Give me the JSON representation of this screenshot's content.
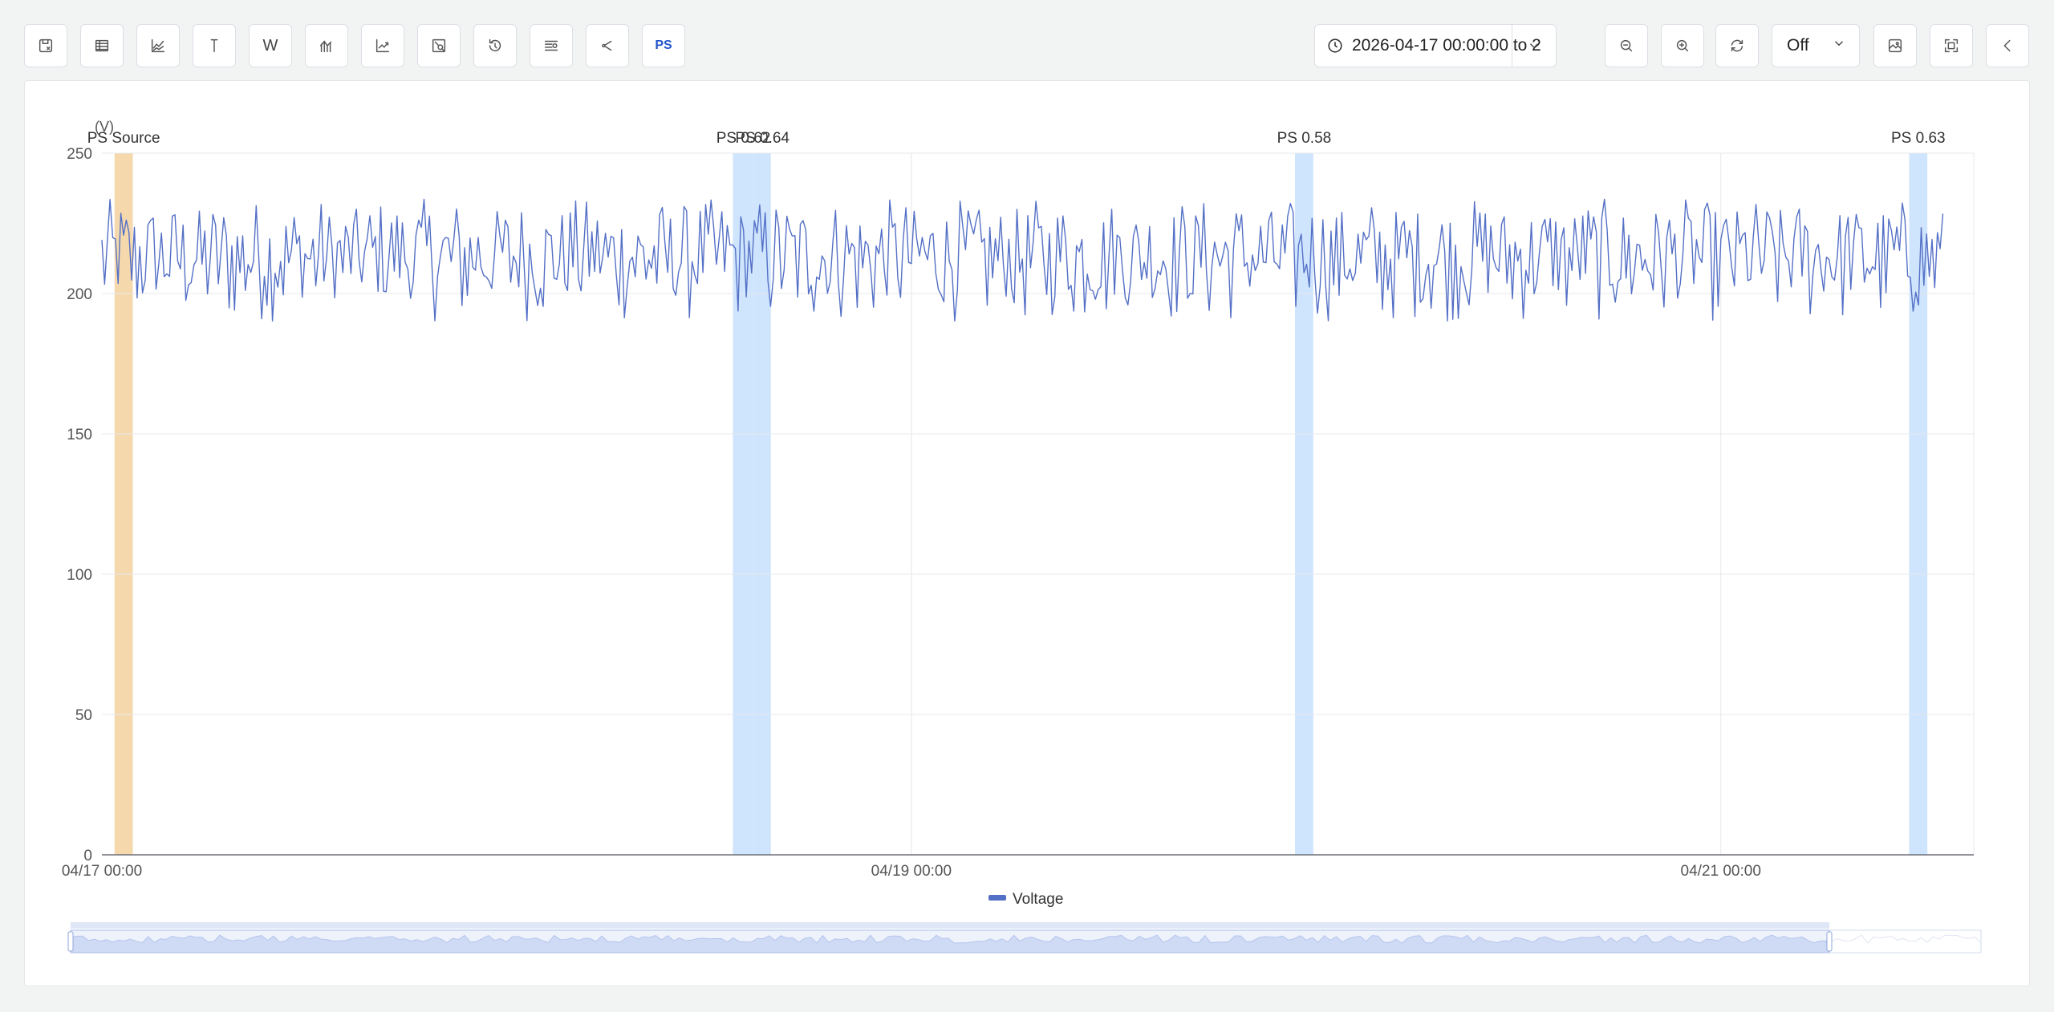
{
  "toolbar": {
    "left_buttons": [
      {
        "name": "save-icon"
      },
      {
        "name": "table-icon"
      },
      {
        "name": "line-chart-icon"
      },
      {
        "name": "cursor-icon"
      },
      {
        "name": "w-icon",
        "label": "W"
      },
      {
        "name": "multi-axis-icon"
      },
      {
        "name": "trend-icon"
      },
      {
        "name": "region-zoom-icon"
      },
      {
        "name": "history-icon"
      },
      {
        "name": "filter-icon"
      },
      {
        "name": "share-icon"
      },
      {
        "name": "ps-icon",
        "label": "PS"
      }
    ],
    "range_text": "2026-04-17 00:00:00 to 2",
    "refresh_select": "Off",
    "right_buttons": [
      {
        "name": "zoom-out-icon"
      },
      {
        "name": "zoom-in-icon"
      },
      {
        "name": "refresh-icon"
      },
      {
        "name": "export-image-icon"
      },
      {
        "name": "fullscreen-icon"
      },
      {
        "name": "collapse-icon"
      }
    ]
  },
  "colors": {
    "line": "#5470c6",
    "source_band": "#f5d9ad",
    "ps_band": "#cfe5fd",
    "grid": "#e6e8eb",
    "slider_fill": "#d9e2f7"
  },
  "chart_data": {
    "type": "line",
    "ylabel": "(V)",
    "ylim": [
      0,
      250
    ],
    "yticks": [
      0,
      50,
      100,
      150,
      200,
      250
    ],
    "xlim": [
      "04/17 00:00",
      "04/21 15:00"
    ],
    "xticks": [
      "04/17 00:00",
      "04/19 00:00",
      "04/21 00:00"
    ],
    "series": [
      {
        "name": "Voltage",
        "y_range": [
          190,
          236
        ],
        "mean": 212,
        "sampling": "dense, ~every 10 min"
      }
    ],
    "bands": [
      {
        "label": "PS Source",
        "start": "04/17 00:45",
        "end": "04/17 01:50",
        "kind": "source"
      },
      {
        "label": "PS 0.62",
        "start": "04/18 13:25",
        "end": "04/18 14:40",
        "kind": "ps"
      },
      {
        "label": "PS 0.64",
        "start": "04/18 14:40",
        "end": "04/18 15:40",
        "kind": "ps"
      },
      {
        "label": "PS 0.58",
        "start": "04/19 22:45",
        "end": "04/19 23:50",
        "kind": "ps"
      },
      {
        "label": "PS 0.63",
        "start": "04/21 11:10",
        "end": "04/21 12:15",
        "kind": "ps"
      }
    ],
    "legend": "bottom-center",
    "grid": true
  }
}
